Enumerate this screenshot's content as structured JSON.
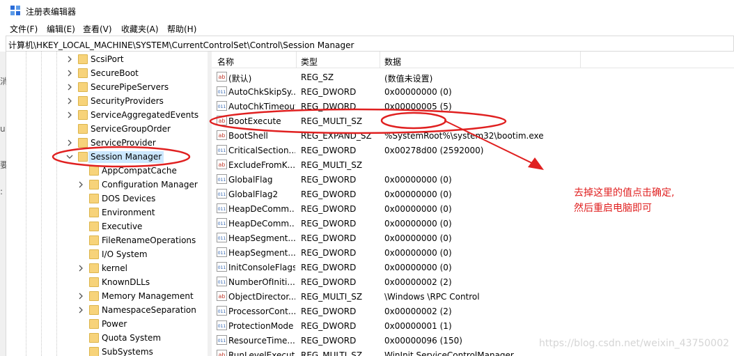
{
  "window": {
    "title": "注册表编辑器",
    "app_icon": "regedit-icon"
  },
  "menu": [
    "文件(F)",
    "编辑(E)",
    "查看(V)",
    "收藏夹(A)",
    "帮助(H)"
  ],
  "address": "计算机\\HKEY_LOCAL_MACHINE\\SYSTEM\\CurrentControlSet\\Control\\Session Manager",
  "left_fragments": [
    "消",
    "u",
    "要",
    ":"
  ],
  "tree": {
    "items": [
      {
        "label": "ScsiPort",
        "depth": 0,
        "expander": "right",
        "selected": false
      },
      {
        "label": "SecureBoot",
        "depth": 0,
        "expander": "right",
        "selected": false
      },
      {
        "label": "SecurePipeServers",
        "depth": 0,
        "expander": "right",
        "selected": false
      },
      {
        "label": "SecurityProviders",
        "depth": 0,
        "expander": "right",
        "selected": false
      },
      {
        "label": "ServiceAggregatedEvents",
        "depth": 0,
        "expander": "right",
        "selected": false
      },
      {
        "label": "ServiceGroupOrder",
        "depth": 0,
        "expander": "none",
        "selected": false
      },
      {
        "label": "ServiceProvider",
        "depth": 0,
        "expander": "right",
        "selected": false
      },
      {
        "label": "Session Manager",
        "depth": 0,
        "expander": "down",
        "selected": true
      },
      {
        "label": "AppCompatCache",
        "depth": 1,
        "expander": "none",
        "selected": false
      },
      {
        "label": "Configuration Manager",
        "depth": 1,
        "expander": "right",
        "selected": false
      },
      {
        "label": "DOS Devices",
        "depth": 1,
        "expander": "none",
        "selected": false
      },
      {
        "label": "Environment",
        "depth": 1,
        "expander": "none",
        "selected": false
      },
      {
        "label": "Executive",
        "depth": 1,
        "expander": "none",
        "selected": false
      },
      {
        "label": "FileRenameOperations",
        "depth": 1,
        "expander": "none",
        "selected": false
      },
      {
        "label": "I/O System",
        "depth": 1,
        "expander": "none",
        "selected": false
      },
      {
        "label": "kernel",
        "depth": 1,
        "expander": "right",
        "selected": false
      },
      {
        "label": "KnownDLLs",
        "depth": 1,
        "expander": "none",
        "selected": false
      },
      {
        "label": "Memory Management",
        "depth": 1,
        "expander": "right",
        "selected": false
      },
      {
        "label": "NamespaceSeparation",
        "depth": 1,
        "expander": "right",
        "selected": false
      },
      {
        "label": "Power",
        "depth": 1,
        "expander": "none",
        "selected": false
      },
      {
        "label": "Quota System",
        "depth": 1,
        "expander": "none",
        "selected": false
      },
      {
        "label": "SubSystems",
        "depth": 1,
        "expander": "none",
        "selected": false
      }
    ]
  },
  "list": {
    "headers": {
      "name": "名称",
      "type": "类型",
      "data": "数据"
    },
    "rows": [
      {
        "icon": "ab",
        "name": "(默认)",
        "type": "REG_SZ",
        "data": "(数值未设置)"
      },
      {
        "icon": "bin",
        "name": "AutoChkSkipSy...",
        "type": "REG_DWORD",
        "data": "0x00000000 (0)"
      },
      {
        "icon": "bin",
        "name": "AutoChkTimeout",
        "type": "REG_DWORD",
        "data": "0x00000005 (5)"
      },
      {
        "icon": "ab",
        "name": "BootExecute",
        "type": "REG_MULTI_SZ",
        "data": ""
      },
      {
        "icon": "ab",
        "name": "BootShell",
        "type": "REG_EXPAND_SZ",
        "data": "%SystemRoot%\\system32\\bootim.exe"
      },
      {
        "icon": "bin",
        "name": "CriticalSection...",
        "type": "REG_DWORD",
        "data": "0x00278d00 (2592000)"
      },
      {
        "icon": "ab",
        "name": "ExcludeFromK...",
        "type": "REG_MULTI_SZ",
        "data": ""
      },
      {
        "icon": "bin",
        "name": "GlobalFlag",
        "type": "REG_DWORD",
        "data": "0x00000000 (0)"
      },
      {
        "icon": "bin",
        "name": "GlobalFlag2",
        "type": "REG_DWORD",
        "data": "0x00000000 (0)"
      },
      {
        "icon": "bin",
        "name": "HeapDeComm...",
        "type": "REG_DWORD",
        "data": "0x00000000 (0)"
      },
      {
        "icon": "bin",
        "name": "HeapDeComm...",
        "type": "REG_DWORD",
        "data": "0x00000000 (0)"
      },
      {
        "icon": "bin",
        "name": "HeapSegment...",
        "type": "REG_DWORD",
        "data": "0x00000000 (0)"
      },
      {
        "icon": "bin",
        "name": "HeapSegment...",
        "type": "REG_DWORD",
        "data": "0x00000000 (0)"
      },
      {
        "icon": "bin",
        "name": "InitConsoleFlags",
        "type": "REG_DWORD",
        "data": "0x00000000 (0)"
      },
      {
        "icon": "bin",
        "name": "NumberOfIniti...",
        "type": "REG_DWORD",
        "data": "0x00000002 (2)"
      },
      {
        "icon": "ab",
        "name": "ObjectDirector...",
        "type": "REG_MULTI_SZ",
        "data": "\\Windows \\RPC Control"
      },
      {
        "icon": "bin",
        "name": "ProcessorCont...",
        "type": "REG_DWORD",
        "data": "0x00000002 (2)"
      },
      {
        "icon": "bin",
        "name": "ProtectionMode",
        "type": "REG_DWORD",
        "data": "0x00000001 (1)"
      },
      {
        "icon": "bin",
        "name": "ResourceTime...",
        "type": "REG_DWORD",
        "data": "0x00000096 (150)"
      },
      {
        "icon": "ab",
        "name": "RunLevelExecute",
        "type": "REG_MULTI_SZ",
        "data": "WinInit ServiceControlManager"
      }
    ]
  },
  "annotation": {
    "line1": "去掉这里的值点击确定,",
    "line2": "然后重启电脑即可",
    "color": "#e02020"
  },
  "watermark": "https://blog.csdn.net/weixin_43750002",
  "colors": {
    "selection": "#cce8ff",
    "folder": "#f7d37a",
    "annotation": "#e02020"
  }
}
